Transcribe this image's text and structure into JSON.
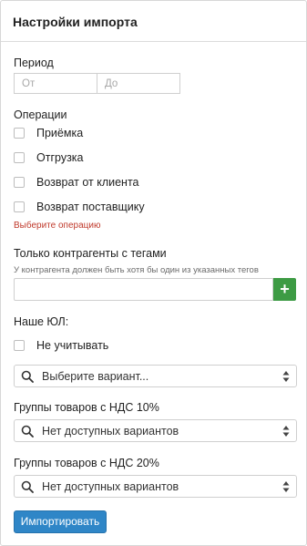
{
  "panel": {
    "title": "Настройки импорта"
  },
  "period": {
    "label": "Период",
    "from_placeholder": "От",
    "to_placeholder": "До"
  },
  "operations": {
    "label": "Операции",
    "items": [
      {
        "label": "Приёмка",
        "checked": false
      },
      {
        "label": "Отгрузка",
        "checked": false
      },
      {
        "label": "Возврат от клиента",
        "checked": false
      },
      {
        "label": "Возврат поставщику",
        "checked": false
      }
    ],
    "error": "Выберите операцию"
  },
  "tags": {
    "label": "Только контрагенты с тегами",
    "hint": "У контрагента должен быть хотя бы один из указанных тегов",
    "add_label": "+"
  },
  "legal_entity": {
    "label": "Наше ЮЛ:",
    "ignore_label": "Не учитывать",
    "select_placeholder": "Выберите вариант..."
  },
  "vat10": {
    "label": "Группы товаров с НДС 10%",
    "select_value": "Нет доступных вариантов"
  },
  "vat20": {
    "label": "Группы товаров с НДС 20%",
    "select_value": "Нет доступных вариантов"
  },
  "actions": {
    "import_label": "Импортировать"
  },
  "colors": {
    "accent": "#2f86c7",
    "success": "#3d9b44",
    "error": "#c0392b"
  },
  "icons": {
    "search": "search-icon",
    "sort": "sort-caret-icon",
    "add": "plus-icon"
  }
}
